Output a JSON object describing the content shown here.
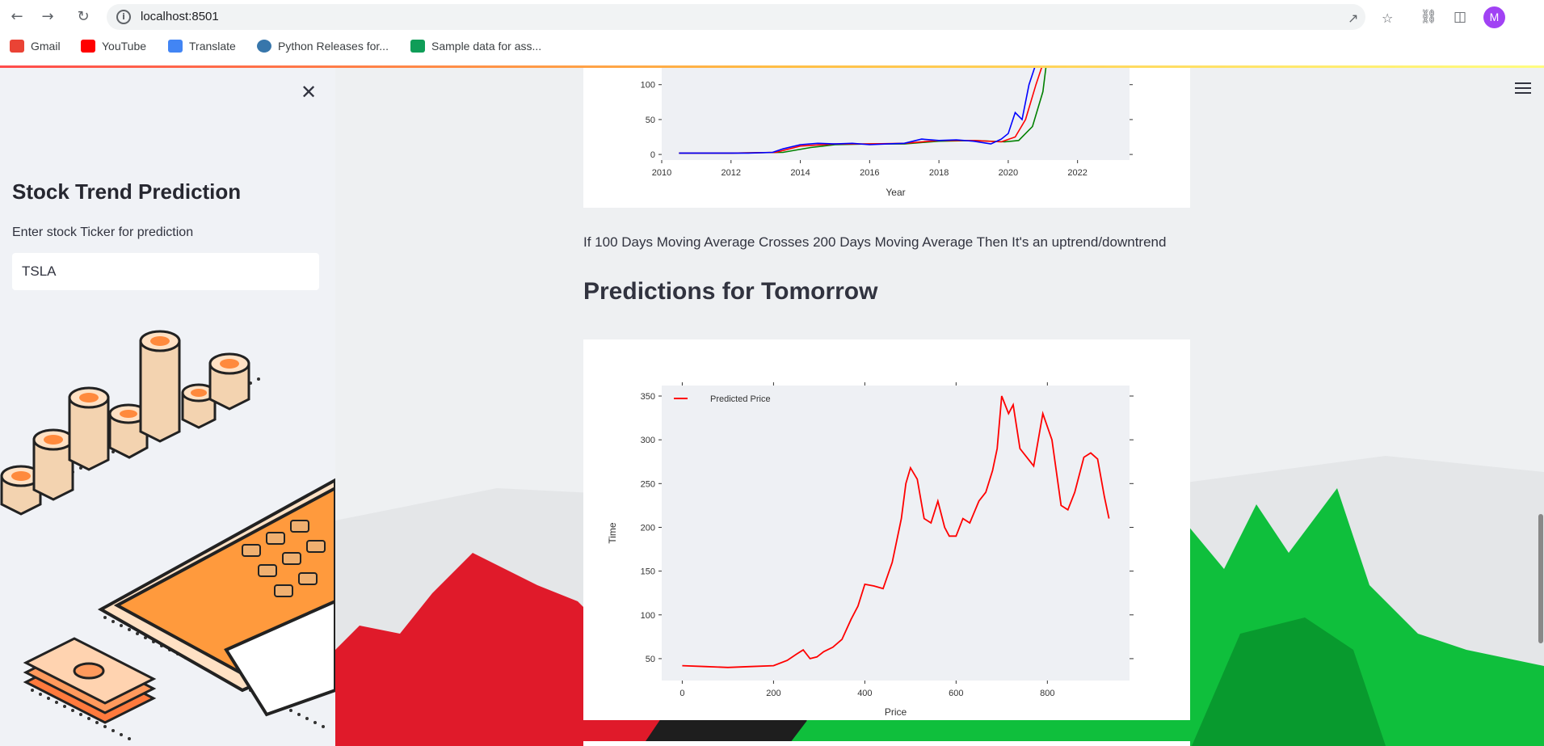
{
  "browser": {
    "url": "localhost:8501",
    "avatar_letter": "M",
    "bookmarks": [
      {
        "label": "Gmail",
        "color": "#ea4335"
      },
      {
        "label": "YouTube",
        "color": "#ff0000"
      },
      {
        "label": "Translate",
        "color": "#4285f4"
      },
      {
        "label": "Python Releases for...",
        "color": "#3776ab"
      },
      {
        "label": "Sample data for ass...",
        "color": "#0f9d58"
      }
    ]
  },
  "sidebar": {
    "title": "Stock Trend Prediction",
    "input_label": "Enter stock Ticker for prediction",
    "input_value": "TSLA"
  },
  "main": {
    "note": "If 100 Days Moving Average Crosses 200 Days Moving Average Then It's an uptrend/downtrend",
    "predictions_heading": "Predictions for Tomorrow"
  },
  "chart_data": [
    {
      "type": "line",
      "title": "",
      "xlabel": "Year",
      "ylabel": "",
      "x_ticks": [
        "2010",
        "2012",
        "2014",
        "2016",
        "2018",
        "2020",
        "2022"
      ],
      "y_ticks": [
        "0",
        "50",
        "100"
      ],
      "series": [
        {
          "color": "#0000ff",
          "x": [
            2010.5,
            2011.5,
            2012.5,
            2013.2,
            2013.5,
            2014,
            2014.5,
            2015,
            2015.5,
            2016,
            2016.5,
            2017,
            2017.5,
            2018,
            2018.5,
            2019,
            2019.5,
            2019.8,
            2020,
            2020.2,
            2020.4,
            2020.6,
            2020.8
          ],
          "y": [
            2,
            2,
            2,
            3,
            8,
            14,
            16,
            15,
            16,
            14,
            15,
            16,
            22,
            20,
            21,
            19,
            15,
            22,
            30,
            60,
            50,
            100,
            130
          ]
        },
        {
          "color": "#ff0000",
          "x": [
            2010.5,
            2012,
            2013.3,
            2014,
            2015,
            2016,
            2017,
            2018,
            2019,
            2019.8,
            2020.2,
            2020.5,
            2020.8,
            2021.0
          ],
          "y": [
            2,
            2,
            3,
            12,
            15,
            15,
            16,
            20,
            20,
            18,
            25,
            50,
            100,
            130
          ]
        },
        {
          "color": "#008000",
          "x": [
            2010.5,
            2012,
            2013.5,
            2014.3,
            2015,
            2016,
            2017,
            2018,
            2019,
            2019.9,
            2020.3,
            2020.7,
            2021.0,
            2021.1
          ],
          "y": [
            2,
            2,
            3,
            10,
            14,
            15,
            15,
            19,
            20,
            18,
            20,
            40,
            90,
            130
          ]
        }
      ]
    },
    {
      "type": "line",
      "title": "",
      "xlabel": "Price",
      "ylabel": "Time",
      "x_ticks": [
        "0",
        "200",
        "400",
        "600",
        "800"
      ],
      "y_ticks": [
        "50",
        "100",
        "150",
        "200",
        "250",
        "300",
        "350"
      ],
      "legend": "top-left",
      "series": [
        {
          "name": "Predicted Price",
          "color": "#ff0000",
          "x": [
            0,
            50,
            100,
            150,
            200,
            230,
            250,
            265,
            280,
            295,
            310,
            330,
            350,
            370,
            385,
            400,
            420,
            440,
            460,
            480,
            490,
            500,
            515,
            530,
            545,
            560,
            575,
            585,
            600,
            615,
            630,
            650,
            665,
            680,
            690,
            700,
            715,
            725,
            740,
            755,
            770,
            790,
            810,
            830,
            845,
            860,
            880,
            895,
            910,
            925,
            935
          ],
          "y": [
            42,
            41,
            40,
            41,
            42,
            48,
            55,
            60,
            50,
            52,
            58,
            63,
            72,
            95,
            110,
            135,
            133,
            130,
            160,
            210,
            250,
            268,
            255,
            210,
            205,
            230,
            200,
            190,
            190,
            210,
            205,
            230,
            240,
            265,
            290,
            350,
            330,
            340,
            290,
            280,
            270,
            330,
            300,
            225,
            220,
            240,
            280,
            285,
            278,
            235,
            210
          ]
        }
      ]
    }
  ]
}
